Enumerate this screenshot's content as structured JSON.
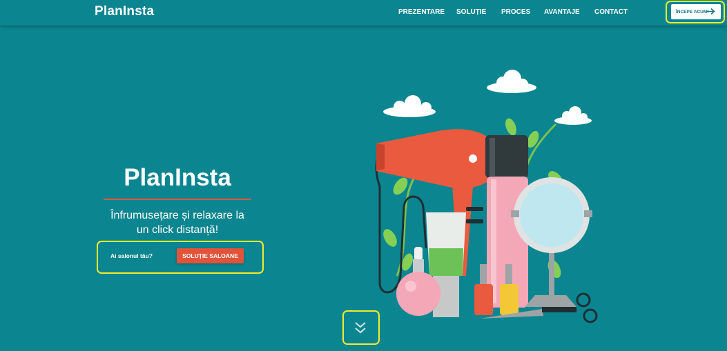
{
  "brand": "PlanInsta",
  "nav": {
    "items": [
      {
        "label": "PREZENTARE"
      },
      {
        "label": "SOLUȚIE"
      },
      {
        "label": "PROCES"
      },
      {
        "label": "AVANTAJE"
      },
      {
        "label": "CONTACT"
      }
    ],
    "cta_label": "ÎNCEPE ACUM!",
    "cta_icon": "arrow-right-icon"
  },
  "hero": {
    "title": "PlanInsta",
    "subtitle_line1": "Înfrumusețare și relaxare la",
    "subtitle_line2": "un click distanță!",
    "salon_question": "Ai salonul tău?",
    "salon_button": "SOLUȚIE SALOANE",
    "scroll_icon": "double-chevron-down-icon"
  },
  "colors": {
    "background": "#0b8590",
    "accent": "#e2533a",
    "highlight": "#f2ec2b"
  }
}
